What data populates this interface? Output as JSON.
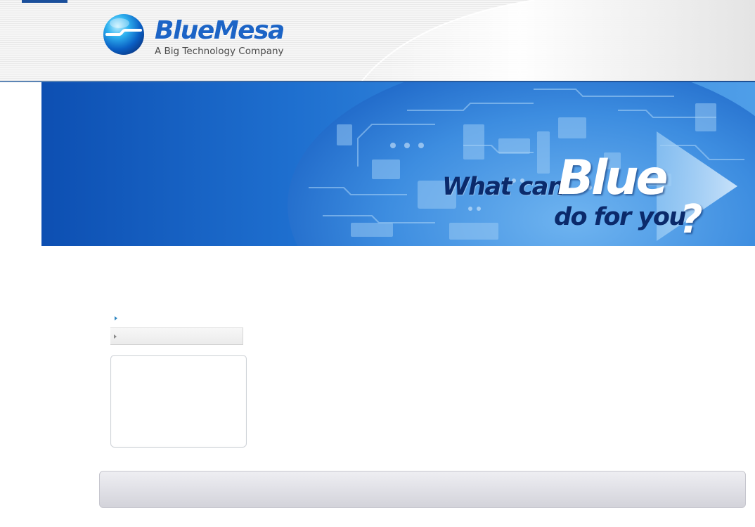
{
  "header": {
    "logo": {
      "name": "BlueMesa",
      "tagline": "A Big Technology Company"
    }
  },
  "banner": {
    "slogan": {
      "line1": "What can",
      "highlight": "Blue",
      "line2": "do for you",
      "punctuation": "?"
    }
  },
  "sidebar": {
    "nav_items": [
      {
        "label": "",
        "icon": "arrow-bullet-icon",
        "state": "plain"
      },
      {
        "label": "",
        "icon": "arrow-bullet-icon",
        "state": "highlighted"
      }
    ]
  },
  "colors": {
    "brand_blue": "#1c64c6",
    "banner_dark": "#0d4fb2",
    "slogan_navy": "#0b2a6b",
    "header_rule": "#2c5fa0"
  }
}
